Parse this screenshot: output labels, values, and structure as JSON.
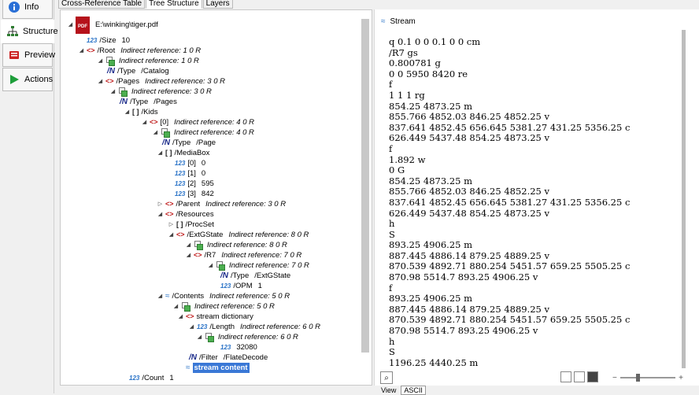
{
  "sidebar": {
    "items": [
      {
        "label": "Info"
      },
      {
        "label": "Structure"
      },
      {
        "label": "Preview"
      },
      {
        "label": "Actions"
      }
    ]
  },
  "tabs": [
    {
      "label": "Cross-Reference Table"
    },
    {
      "label": "Tree Structure"
    },
    {
      "label": "Layers"
    }
  ],
  "tree": {
    "file": "E:\\winking\\tiger.pdf",
    "rows": [
      {
        "icon": "123",
        "key": "/Size",
        "value": "10"
      },
      {
        "icon": "dict",
        "key": "/Root",
        "value": "Indirect reference: 1 0 R"
      },
      {
        "icon": "ref",
        "key": "",
        "value": "Indirect reference: 1 0 R"
      },
      {
        "icon": "name",
        "key": "/Type",
        "value": "/Catalog"
      },
      {
        "icon": "dict",
        "key": "/Pages",
        "value": "Indirect reference: 3 0 R"
      },
      {
        "icon": "ref",
        "key": "",
        "value": "Indirect reference: 3 0 R"
      },
      {
        "icon": "name",
        "key": "/Type",
        "value": "/Pages"
      },
      {
        "icon": "arr",
        "key": "/Kids",
        "value": ""
      },
      {
        "icon": "dict",
        "key": "[0]",
        "value": "Indirect reference: 4 0 R"
      },
      {
        "icon": "ref",
        "key": "",
        "value": "Indirect reference: 4 0 R"
      },
      {
        "icon": "name",
        "key": "/Type",
        "value": "/Page"
      },
      {
        "icon": "arr",
        "key": "/MediaBox",
        "value": ""
      },
      {
        "icon": "123",
        "key": "[0]",
        "value": "0"
      },
      {
        "icon": "123",
        "key": "[1]",
        "value": "0"
      },
      {
        "icon": "123",
        "key": "[2]",
        "value": "595"
      },
      {
        "icon": "123",
        "key": "[3]",
        "value": "842"
      },
      {
        "icon": "dict",
        "key": "/Parent",
        "value": "Indirect reference: 3 0 R"
      },
      {
        "icon": "dict",
        "key": "/Resources",
        "value": ""
      },
      {
        "icon": "arr",
        "key": "/ProcSet",
        "value": ""
      },
      {
        "icon": "dict",
        "key": "/ExtGState",
        "value": "Indirect reference: 8 0 R"
      },
      {
        "icon": "ref",
        "key": "",
        "value": "Indirect reference: 8 0 R"
      },
      {
        "icon": "dict",
        "key": "/R7",
        "value": "Indirect reference: 7 0 R"
      },
      {
        "icon": "ref",
        "key": "",
        "value": "Indirect reference: 7 0 R"
      },
      {
        "icon": "name",
        "key": "/Type",
        "value": "/ExtGState"
      },
      {
        "icon": "123",
        "key": "/OPM",
        "value": "1"
      },
      {
        "icon": "stream",
        "key": "/Contents",
        "value": "Indirect reference: 5 0 R"
      },
      {
        "icon": "ref",
        "key": "",
        "value": "Indirect reference: 5 0 R"
      },
      {
        "icon": "dict",
        "key": "stream dictionary",
        "value": ""
      },
      {
        "icon": "123",
        "key": "/Length",
        "value": "Indirect reference: 6 0 R"
      },
      {
        "icon": "ref",
        "key": "",
        "value": "Indirect reference: 6 0 R"
      },
      {
        "icon": "123",
        "key": "",
        "value": "32080"
      },
      {
        "icon": "name",
        "key": "/Filter",
        "value": "/FlateDecode"
      },
      {
        "icon": "stream",
        "key": "stream content",
        "value": ""
      },
      {
        "icon": "123",
        "key": "/Count",
        "value": "1"
      }
    ]
  },
  "stream": {
    "title": "Stream",
    "lines": [
      "q 0.1 0 0 0.1 0 0 cm",
      "/R7 gs",
      "0.800781 g",
      "0 0 5950 8420 re",
      "f",
      "1 1 1 rg",
      "854.25 4873.25 m",
      "855.766 4852.03 846.25 4852.25 v",
      "837.641 4852.45 656.645 5381.27 431.25 5356.25 c",
      "626.449 5437.48 854.25 4873.25 v",
      "f",
      "1.892 w",
      "0 G",
      "854.25 4873.25 m",
      "855.766 4852.03 846.25 4852.25 v",
      "837.641 4852.45 656.645 5381.27 431.25 5356.25 c",
      "626.449 5437.48 854.25 4873.25 v",
      "h",
      "S",
      "893.25 4906.25 m",
      "887.445 4886.14 879.25 4889.25 v",
      "870.539 4892.71 880.254 5451.57 659.25 5505.25 c",
      "870.98 5514.7 893.25 4906.25 v",
      "f",
      "893.25 4906.25 m",
      "887.445 4886.14 879.25 4889.25 v",
      "870.539 4892.71 880.254 5451.57 659.25 5505.25 c",
      "870.98 5514.7 893.25 4906.25 v",
      "h",
      "S",
      "1196.25 4440.25 m"
    ]
  },
  "footer": {
    "view_label": "View",
    "mode": "ASCII"
  }
}
